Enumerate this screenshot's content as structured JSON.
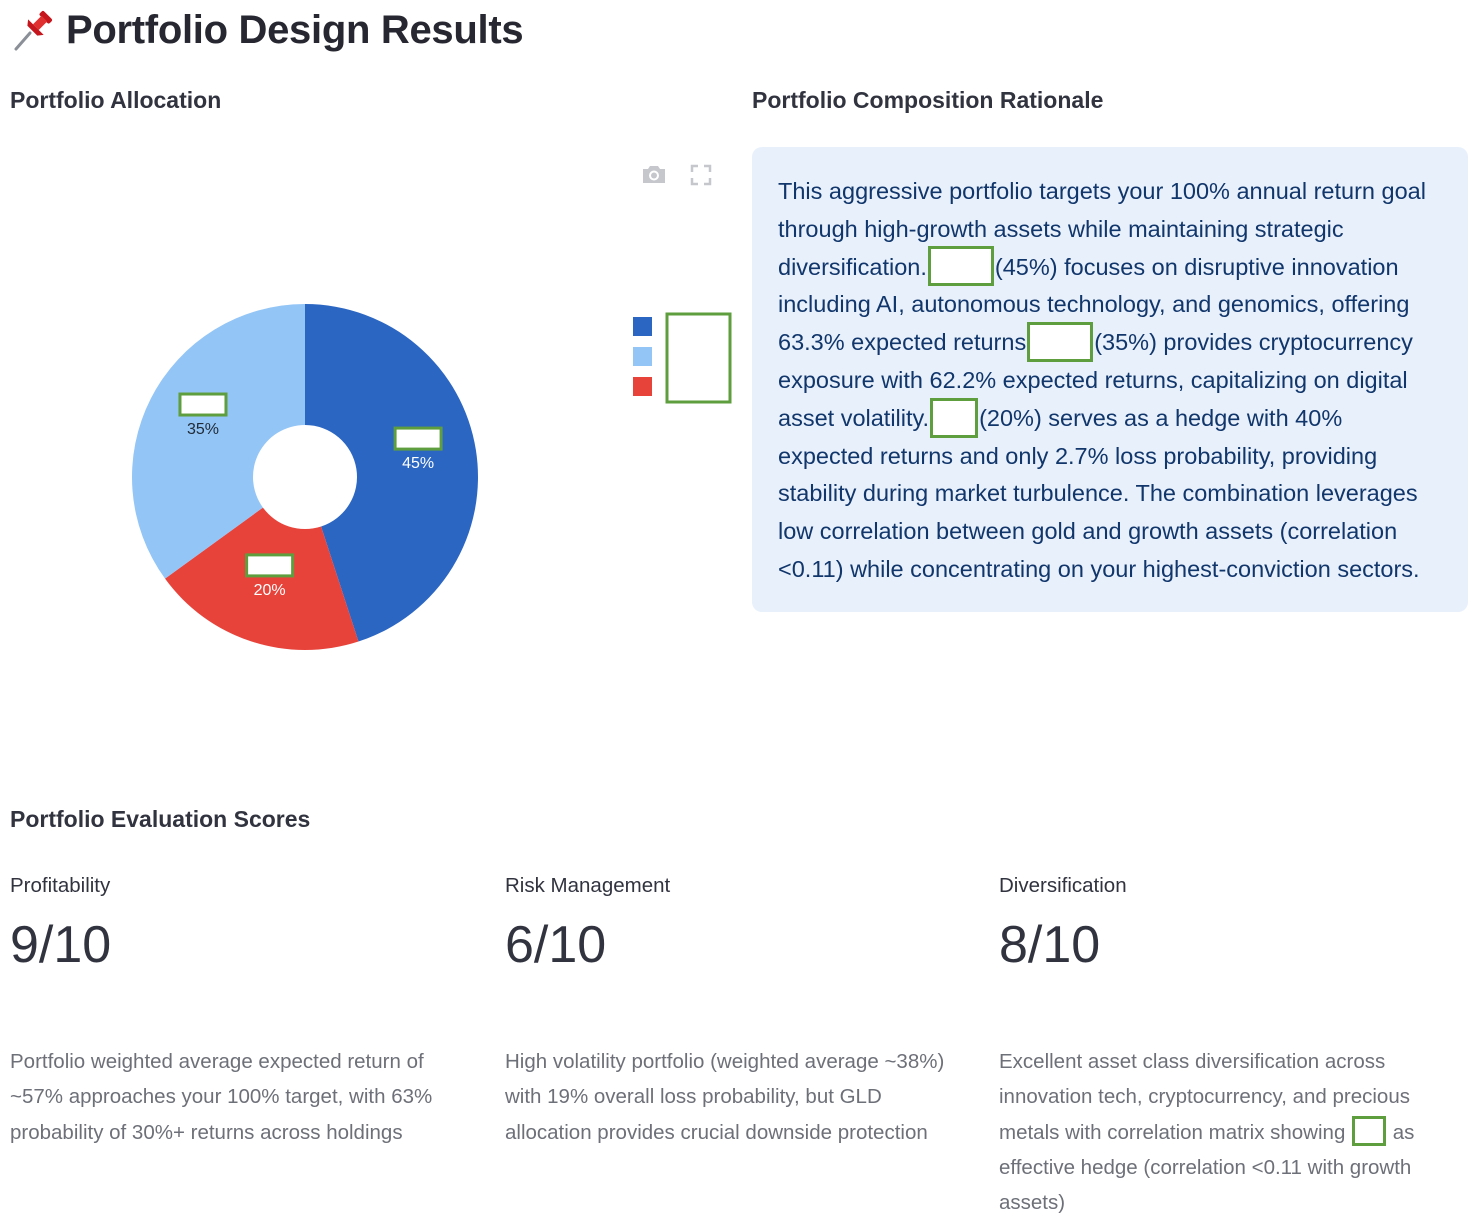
{
  "page": {
    "title": "Portfolio Design Results",
    "title_icon": "pushpin-icon"
  },
  "allocation": {
    "heading": "Portfolio Allocation",
    "toolbar": [
      "camera-icon",
      "fullscreen-icon"
    ],
    "chart_data": {
      "type": "pie",
      "donut": true,
      "slices": [
        {
          "label": "",
          "value": 45,
          "display": "45%",
          "color": "#2b66c3"
        },
        {
          "label": "",
          "value": 20,
          "display": "20%",
          "color": "#e8433b"
        },
        {
          "label": "",
          "value": 35,
          "display": "35%",
          "color": "#93c5f6"
        }
      ],
      "legend": {
        "placement": "right",
        "swatches": [
          "#2b66c3",
          "#93c5f6",
          "#e8433b"
        ]
      }
    }
  },
  "rationale": {
    "heading": "Portfolio Composition Rationale",
    "part1": "This aggressive portfolio targets your 100% annual return goal through high-growth assets while maintaining strategic diversification.",
    "part2": "(45%) focuses on disruptive innovation including AI, autonomous technology, and genomics, offering 63.3% expected returns",
    "part3": "(35%) provides cryptocurrency exposure with 62.2% expected returns, capitalizing on digital asset volatility.",
    "part4": "(20%) serves as a hedge with 40% expected returns and only 2.7% loss probability, providing stability during market turbulence. The combination leverages low correlation between gold and growth assets (correlation <0.11) while concentrating on your highest-conviction sectors."
  },
  "evaluation": {
    "heading": "Portfolio Evaluation Scores",
    "metrics": [
      {
        "label": "Profitability",
        "value": "9/10",
        "desc": "Portfolio weighted average expected return of ~57% approaches your 100% target, with 63% probability of 30%+ returns across holdings"
      },
      {
        "label": "Risk Management",
        "value": "6/10",
        "desc": "High volatility portfolio (weighted average ~38%) with 19% overall loss probability, but GLD allocation provides crucial downside protection"
      },
      {
        "label": "Diversification",
        "value": "8/10",
        "desc_a": "Excellent asset class diversification across innovation tech, cryptocurrency, and precious metals with correlation matrix showing",
        "desc_b": "as effective hedge (correlation <0.11 with growth assets)"
      }
    ]
  }
}
